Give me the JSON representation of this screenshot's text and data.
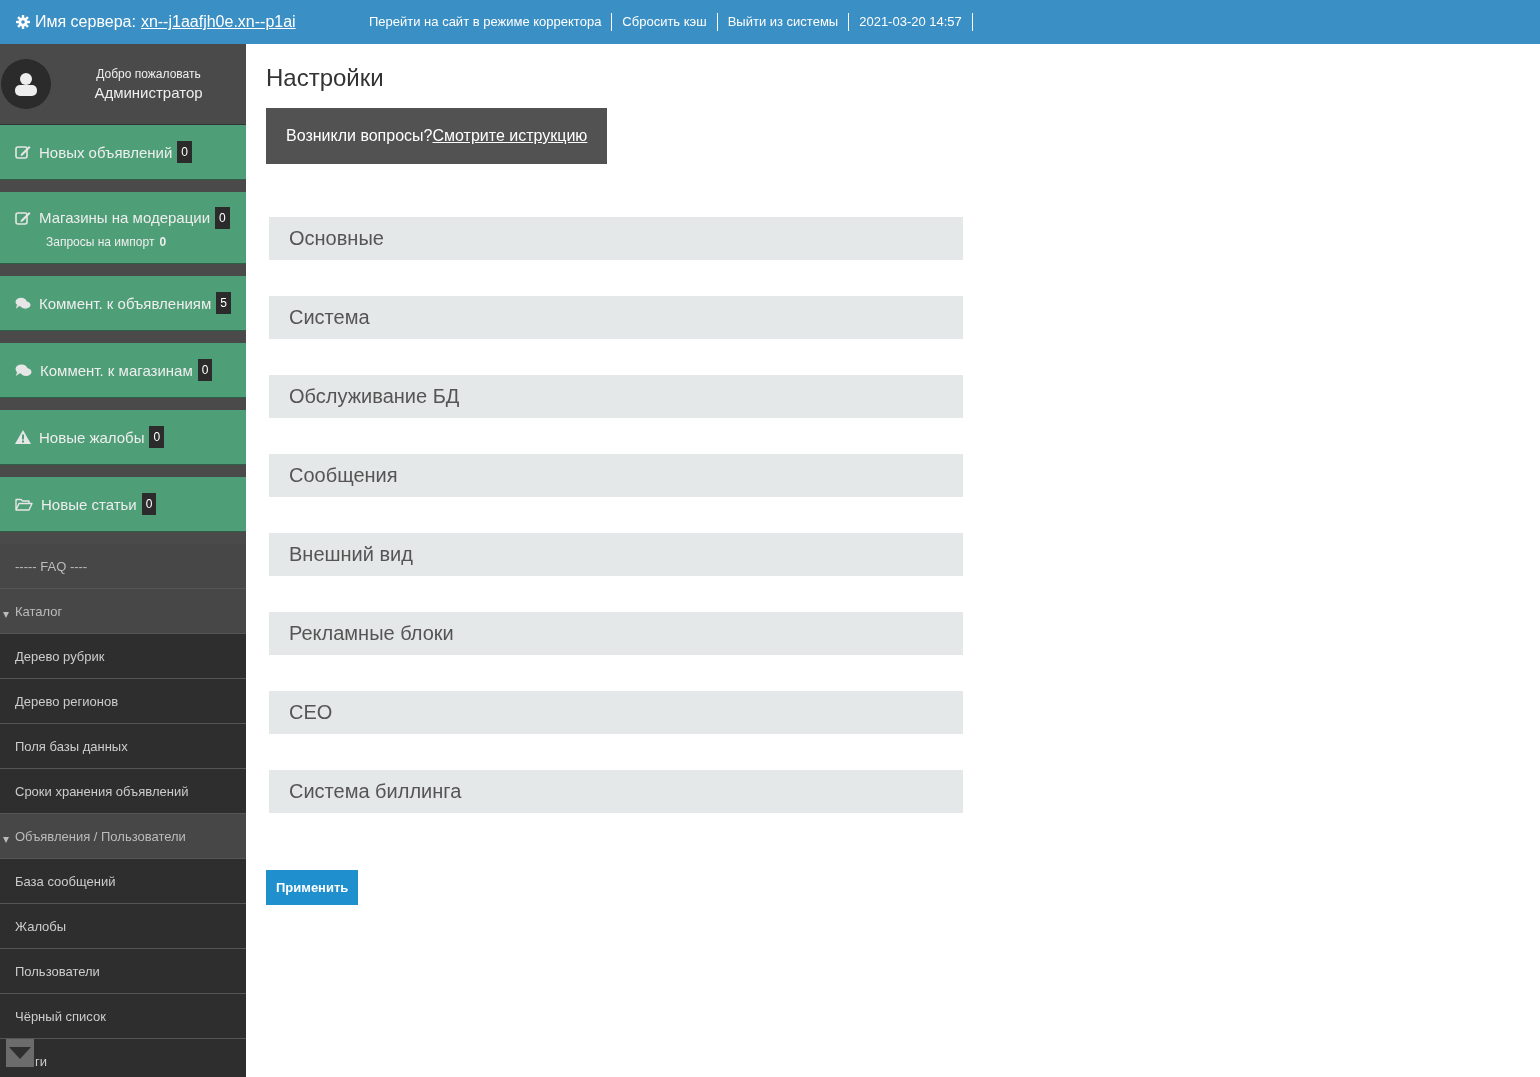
{
  "topbar": {
    "server_label": "Имя сервера:",
    "server_name": "xn--j1aafjh0e.xn--p1ai",
    "links": [
      "Перейти на сайт в режиме корректора",
      "Сбросить кэш",
      "Выйти из системы"
    ],
    "datetime": "2021-03-20 14:57"
  },
  "user": {
    "greeting": "Добро пожаловать",
    "name": "Администратор"
  },
  "counters": [
    {
      "kind": "edit",
      "label": "Новых объявлений",
      "count": "0"
    },
    {
      "kind": "edit",
      "label": "Магазины на модерации",
      "count": "0",
      "sub_label": "Запросы на импорт",
      "sub_count": "0"
    },
    {
      "kind": "comments",
      "label": "Коммент. к объявлениям",
      "count": "5"
    },
    {
      "kind": "comments",
      "label": "Коммент. к магазинам",
      "count": "0"
    },
    {
      "kind": "warning",
      "label": "Новые жалобы",
      "count": "0"
    },
    {
      "kind": "folder",
      "label": "Новые статьи",
      "count": "0"
    }
  ],
  "menu": [
    {
      "kind": "heading",
      "label": "----- FAQ ----"
    },
    {
      "kind": "group",
      "label": "Каталог",
      "expanded": true,
      "children": [
        {
          "label": "Дерево рубрик"
        },
        {
          "label": "Дерево регионов"
        },
        {
          "label": "Поля базы данных"
        },
        {
          "label": "Сроки хранения объявлений"
        }
      ]
    },
    {
      "kind": "group",
      "label": "Объявления / Пользователи",
      "expanded": true,
      "children": [
        {
          "label": "База сообщений"
        },
        {
          "label": "Жалобы"
        },
        {
          "label": "Пользователи"
        },
        {
          "label": "Чёрный список"
        },
        {
          "label": "ги"
        }
      ]
    }
  ],
  "page": {
    "title": "Настройки",
    "help_text": "Возникли вопросы?",
    "help_link": "Смотрите иструкцию",
    "sections": [
      "Основные",
      "Система",
      "Обслуживание БД",
      "Сообщения",
      "Внешний вид",
      "Рекламные блоки",
      "СЕО",
      "Система биллинга"
    ],
    "apply_button": "Применить"
  }
}
